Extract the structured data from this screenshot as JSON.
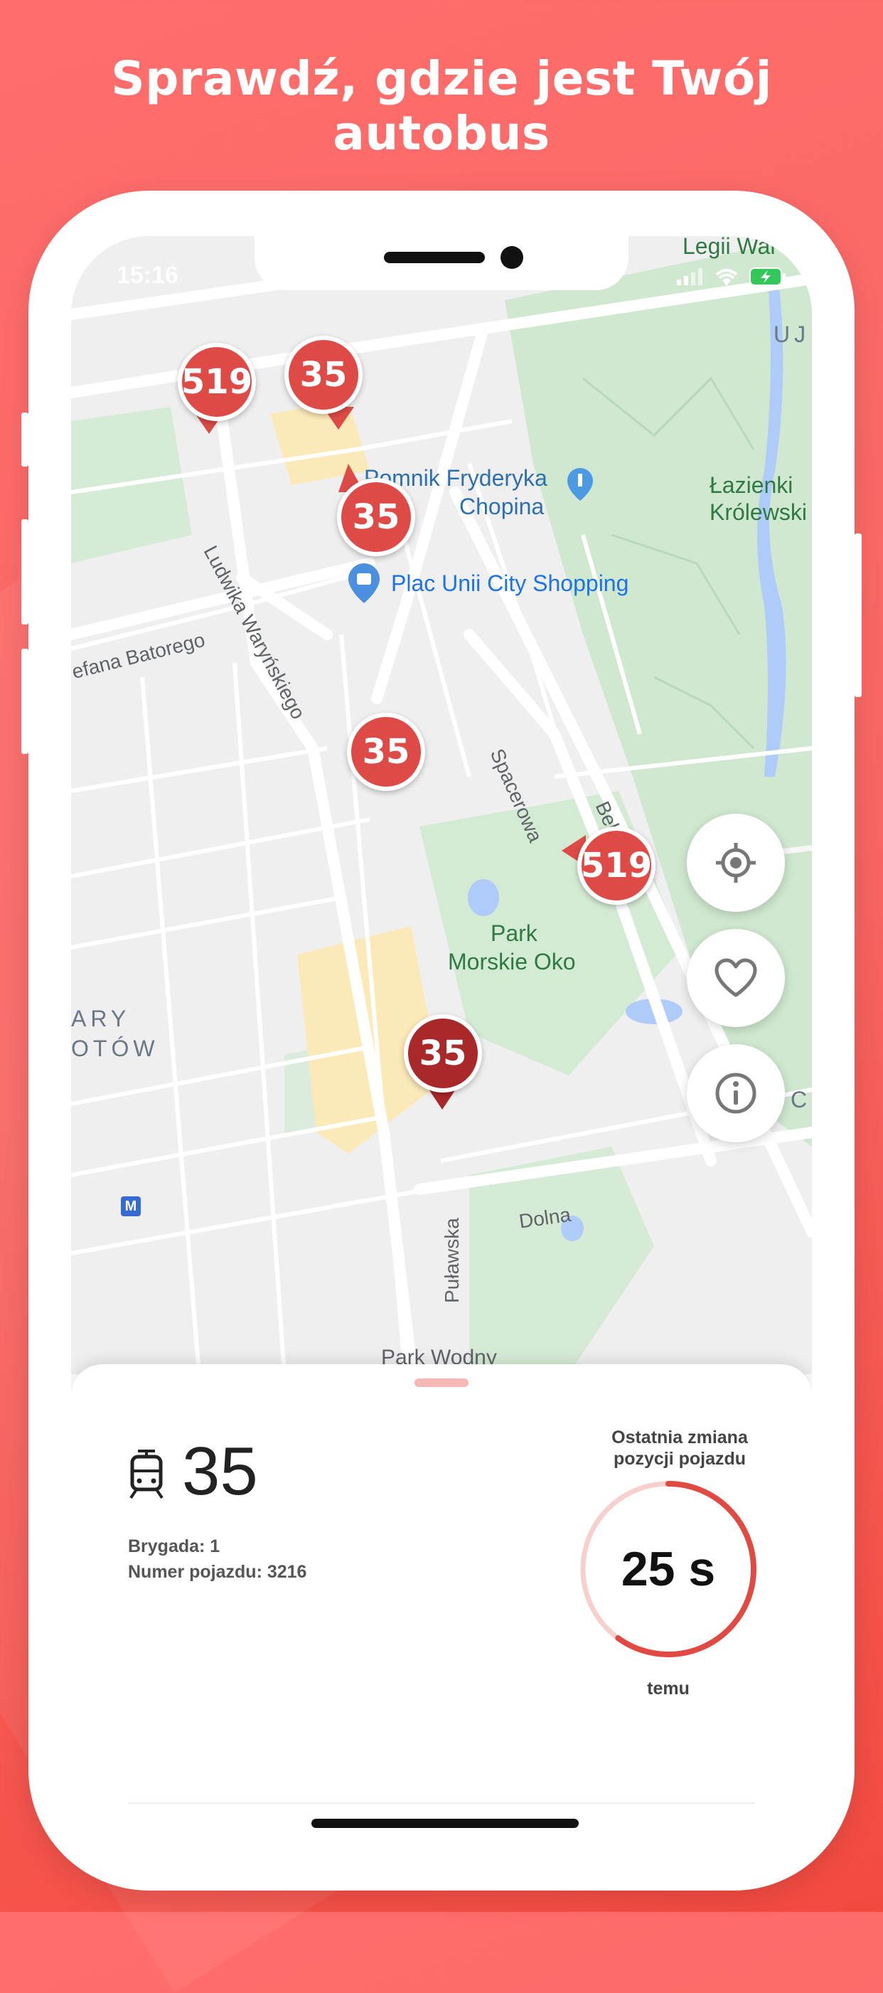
{
  "headline": "Sprawdź, gdzie jest Twój autobus",
  "status_bar": {
    "time": "15:16"
  },
  "map": {
    "street_labels": [
      "Ludwika Waryńskiego",
      "efana Batorego",
      "Spacerowa",
      "Puławska",
      "Dolna",
      "Bel"
    ],
    "poi_labels": [
      "Pomnik Fryderyka",
      "Chopina",
      "Plac Unii City Shopping"
    ],
    "park_labels": [
      "Łazienki",
      "Królewski",
      "Park",
      "Morskie Oko",
      "Legii War",
      "Park Wodny"
    ],
    "district_labels": [
      "ARY",
      "OTÓW",
      "UJ",
      "C"
    ],
    "metro_label": "M",
    "markers": [
      {
        "route": "519",
        "style": "normal"
      },
      {
        "route": "35",
        "style": "normal"
      },
      {
        "route": "35",
        "style": "normal"
      },
      {
        "route": "35",
        "style": "normal"
      },
      {
        "route": "519",
        "style": "normal"
      },
      {
        "route": "35",
        "style": "selected"
      }
    ]
  },
  "controls": {
    "locate": "crosshair-icon",
    "favorite": "heart-icon",
    "info": "info-icon"
  },
  "details": {
    "line": "35",
    "brigade": "Brygada: 1",
    "vehicle": "Numer pojazdu: 3216",
    "timer_caption_line1": "Ostatnia zmiana",
    "timer_caption_line2": "pozycji pojazdu",
    "timer_value": "25 s",
    "timer_progress": 0.6,
    "timer_after": "temu"
  },
  "colors": {
    "accent": "#de4b47",
    "accent_dark": "#a9282a",
    "background": "#f86663"
  }
}
